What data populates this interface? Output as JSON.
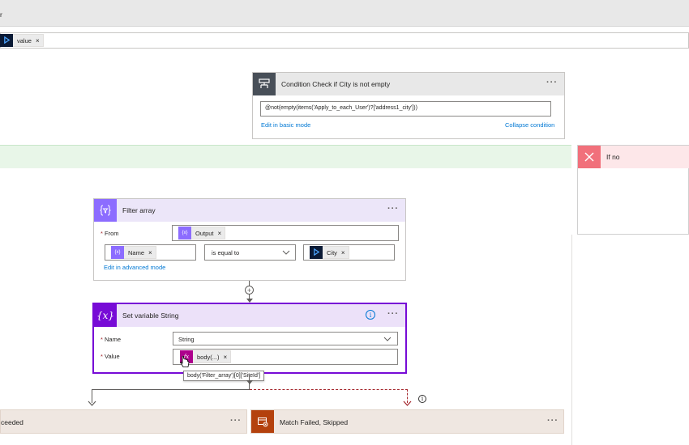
{
  "top_bar": {
    "title_fragment": "r",
    "token_label": "value"
  },
  "condition": {
    "title": "Condition Check if City is not empty",
    "expression": "@not(empty(items('Apply_to_each_User')?['address1_city']))",
    "edit_basic_link": "Edit in basic mode",
    "collapse_link": "Collapse condition",
    "more": "···"
  },
  "if_no": {
    "title": "If no"
  },
  "filter_array": {
    "title": "Filter array",
    "from_label": "From",
    "from_token": "Output",
    "left_token": "Name",
    "operator": "is equal to",
    "right_token": "City",
    "edit_advanced_link": "Edit in advanced mode",
    "more": "···"
  },
  "set_variable": {
    "title": "Set variable String",
    "name_label": "Name",
    "name_value": "String",
    "value_label": "Value",
    "value_token": "body(...)",
    "tooltip": "body('Filter_array')[0]['SiteId']",
    "info_icon": "i",
    "more": "···"
  },
  "bottom": {
    "left_title": "ceeded",
    "right_title": "Match Failed, Skipped",
    "info_icon": "i",
    "more": "···"
  },
  "colors": {
    "scope_header": "#e8e8e8",
    "condition_icon": "#484f58",
    "if_yes_bar": "#e8f6e8",
    "if_no_bar": "#fde7e9",
    "if_no_icon": "#f1707b",
    "filter_header": "#ece6f9",
    "filter_icon": "#8c6cff",
    "variable_header": "#ece1f9",
    "variable_icon": "#770bd6",
    "expression_token": "#ad008c",
    "dataverse_token": "#0b1a35",
    "terminate_header": "#efe7e1",
    "terminate_icon": "#b4410d"
  }
}
